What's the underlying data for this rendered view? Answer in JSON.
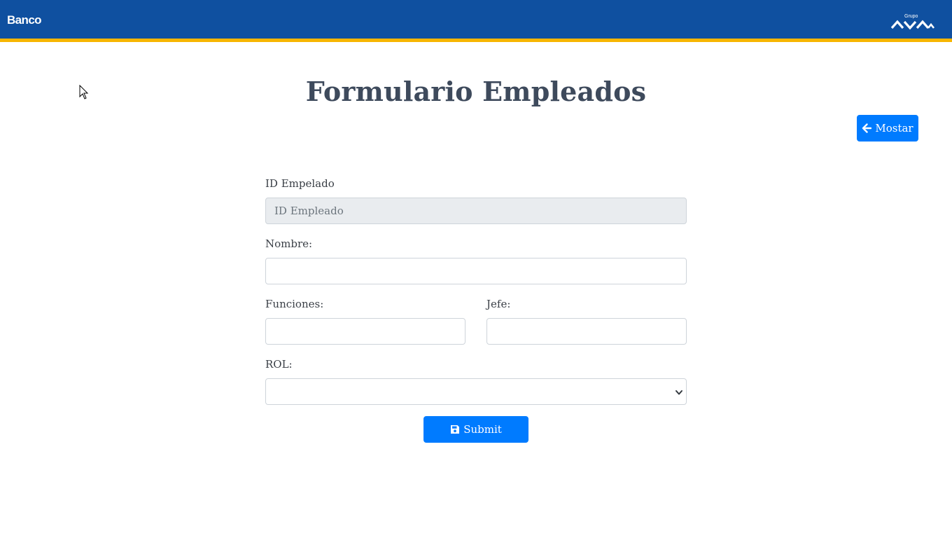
{
  "header": {
    "brand_text": "Banco",
    "logo_text": "Grupo",
    "logo_mark": "AVAL",
    "bar_color": "#0f50a0",
    "accent_color": "#f7b500"
  },
  "page": {
    "title": "Formulario Empleados"
  },
  "actions": {
    "mostar_label": "Mostar",
    "mostar_icon": "arrow-left-icon",
    "submit_label": "Submit",
    "submit_icon": "save-icon",
    "button_color": "#007bff"
  },
  "form": {
    "id_label": "ID Empelado",
    "id_placeholder": "ID Empleado",
    "id_value": "",
    "nombre_label": "Nombre:",
    "nombre_value": "",
    "funciones_label": "Funciones:",
    "funciones_value": "",
    "jefe_label": "Jefe:",
    "jefe_value": "",
    "rol_label": "ROL:",
    "rol_selected": ""
  }
}
